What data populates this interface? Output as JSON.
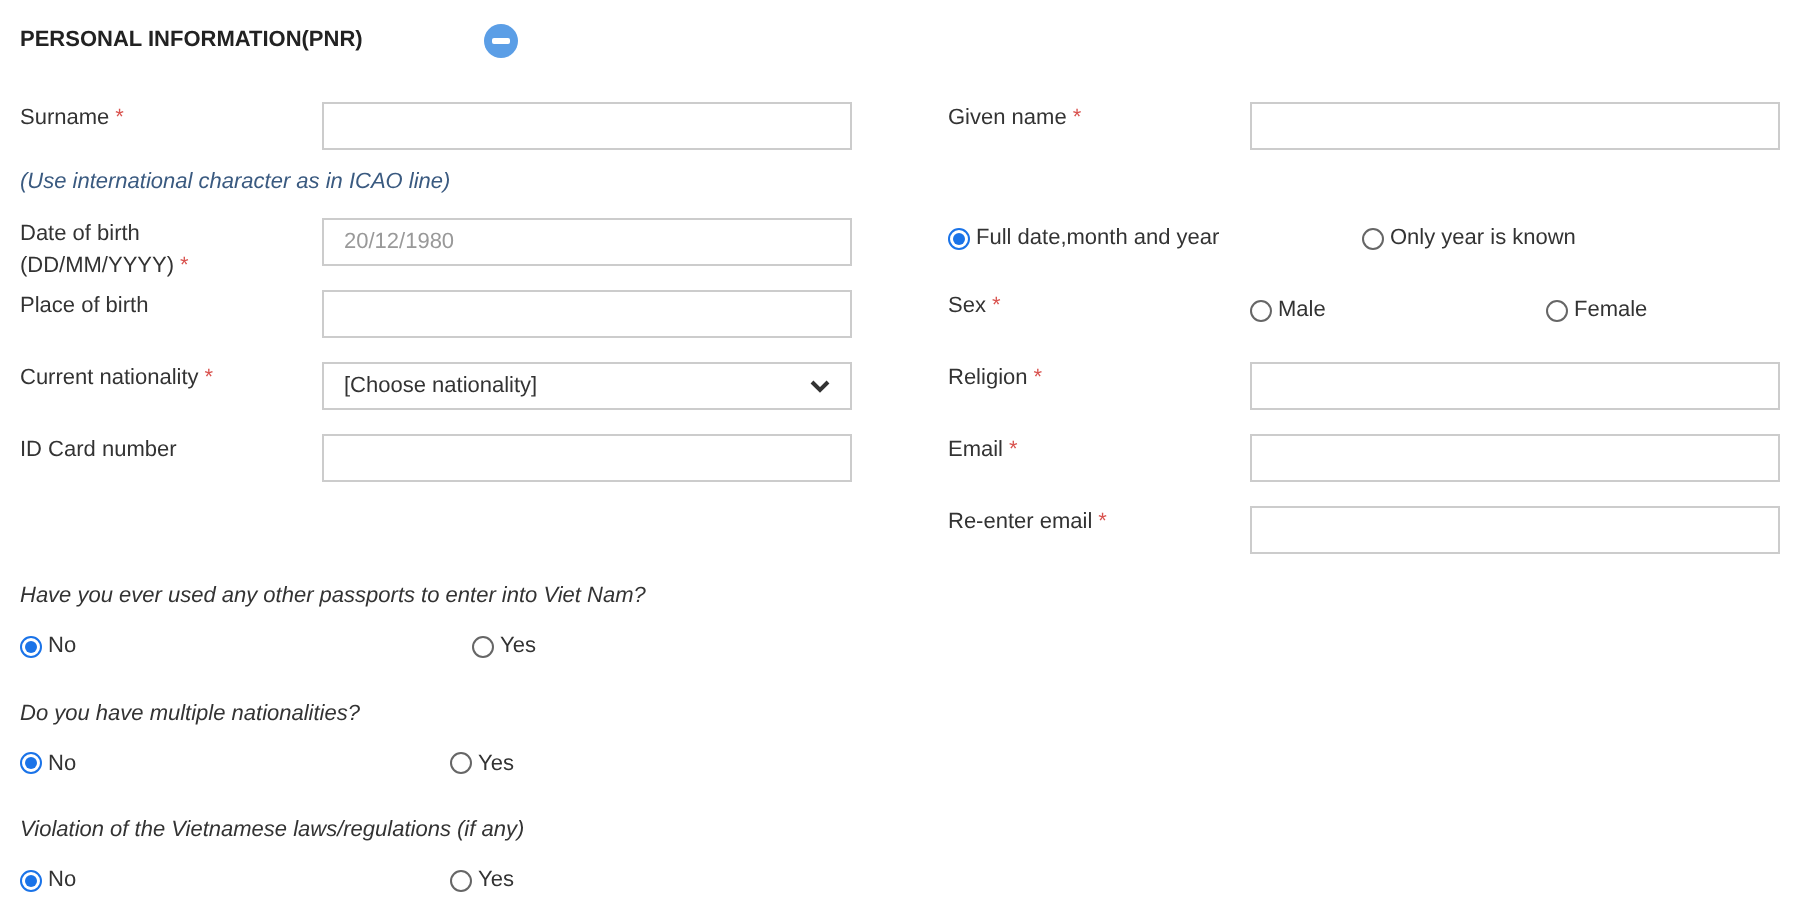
{
  "section": {
    "title": "PERSONAL INFORMATION(PNR)",
    "expanded": true
  },
  "rows": [
    {
      "left": {
        "kind": "input",
        "label": "Surname",
        "required": "*"
      },
      "right": {
        "kind": "input",
        "label": "Given name",
        "required": "*"
      }
    },
    {
      "note": "(Use international character as in ICAO line)"
    },
    {
      "left": {
        "kind": "input",
        "label": "Date of birth (DD/MM/YYYY)",
        "required": "*",
        "placeholder": "20/12/1980"
      },
      "right": {
        "kind": "radios",
        "options": [
          {
            "label": "Full date,month and year",
            "selected": true
          },
          {
            "label": "Only year is known",
            "selected": false
          }
        ]
      }
    },
    {
      "left": {
        "kind": "input",
        "label": "Place of birth"
      },
      "right": {
        "kind": "radios",
        "label": "Sex",
        "required": "*",
        "options": [
          {
            "label": "Male",
            "selected": false
          },
          {
            "label": "Female",
            "selected": false
          }
        ]
      }
    },
    {
      "left": {
        "kind": "select",
        "label": "Current nationality",
        "required": "*",
        "value": "[Choose nationality]"
      },
      "right": {
        "kind": "input",
        "label": "Religion",
        "required": "*"
      }
    },
    {
      "left": {
        "kind": "input",
        "label": "ID Card number"
      },
      "right": {
        "kind": "input",
        "label": "Email",
        "required": "*"
      }
    },
    {
      "right": {
        "kind": "input",
        "label": "Re-enter email",
        "required": "*"
      }
    }
  ],
  "questions": [
    {
      "text": "Have you ever used any other passports to enter into Viet Nam?",
      "options": [
        {
          "label": "No",
          "selected": true
        },
        {
          "label": "Yes",
          "selected": false
        }
      ]
    },
    {
      "text": "Do you have multiple nationalities?",
      "options": [
        {
          "label": "No",
          "selected": true
        },
        {
          "label": "Yes",
          "selected": false
        }
      ]
    },
    {
      "text": "Violation of the Vietnamese laws/regulations (if any)",
      "options": [
        {
          "label": "No",
          "selected": true
        },
        {
          "label": "Yes",
          "selected": false
        }
      ]
    }
  ]
}
